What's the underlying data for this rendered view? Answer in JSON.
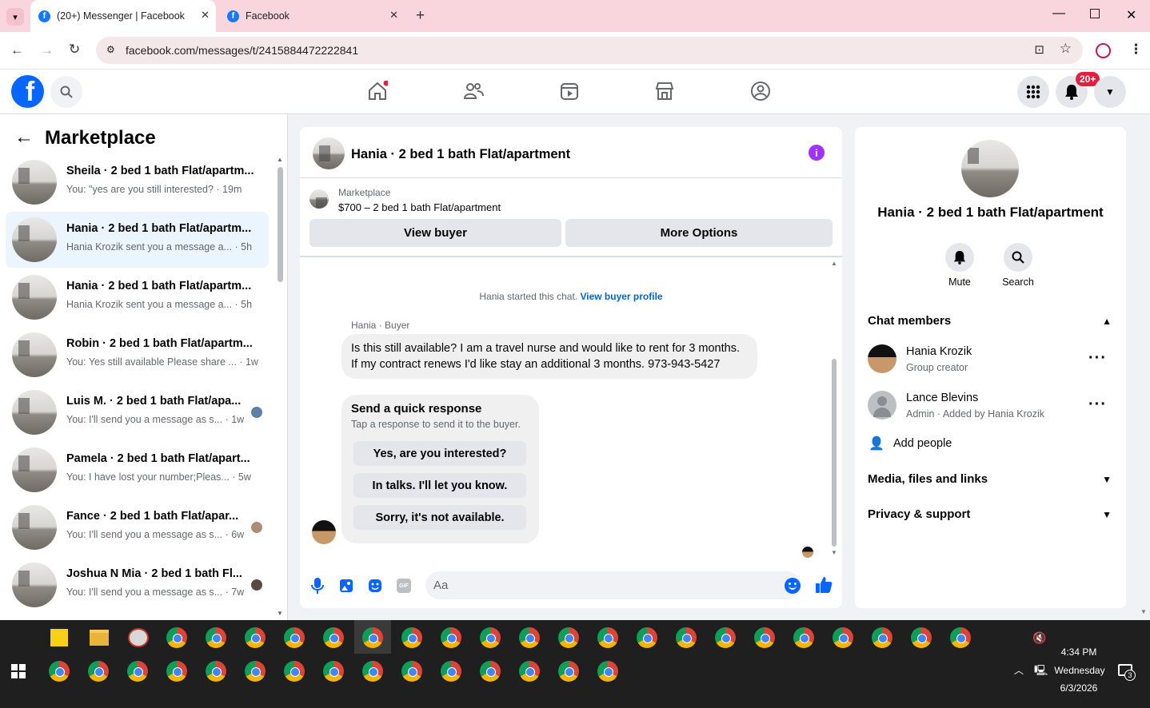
{
  "browser": {
    "tabs": [
      {
        "title": "(20+) Messenger | Facebook"
      },
      {
        "title": "Facebook"
      }
    ],
    "url": "facebook.com/messages/t/2415884472222841"
  },
  "fb": {
    "notif_badge": "20+"
  },
  "left": {
    "title": "Marketplace",
    "conversations": [
      {
        "title": "Sheila · 2 bed 1 bath Flat/apartm...",
        "snippet": "You: \"yes are you still interested? · 19m"
      },
      {
        "title": "Hania · 2 bed 1 bath Flat/apartm...",
        "snippet": "Hania Krozik sent you a message a... · 5h"
      },
      {
        "title": "Hania · 2 bed 1 bath Flat/apartm...",
        "snippet": "Hania Krozik sent you a message a... · 5h"
      },
      {
        "title": "Robin · 2 bed 1 bath Flat/apartm...",
        "snippet": "You: Yes still available Please share ... · 1w"
      },
      {
        "title": "Luis M. · 2 bed 1 bath Flat/apa...",
        "snippet": "You: I'll send you a message as s... · 1w"
      },
      {
        "title": "Pamela · 2 bed 1 bath Flat/apart...",
        "snippet": "You: I have lost your number;Pleas... · 5w"
      },
      {
        "title": "Fance · 2 bed 1 bath Flat/apar...",
        "snippet": "You: I'll send you a message as s... · 6w"
      },
      {
        "title": "Joshua N Mia · 2 bed 1 bath Fl...",
        "snippet": "You: I'll send you a message as s... · 7w"
      }
    ]
  },
  "chat": {
    "header_title": "Hania · 2 bed 1 bath Flat/apartment",
    "listing_source": "Marketplace",
    "listing_line": "$700 – 2 bed 1 bath Flat/apartment",
    "view_buyer": "View buyer",
    "more_options": "More Options",
    "started_text": "Hania started this chat.",
    "view_profile": "View buyer profile",
    "sender_label": "Hania · Buyer",
    "message": "Is this still available? I am a travel nurse and would like to rent for 3 months. If my contract renews I'd like stay an additional 3 months. 973-943-5427",
    "quick_title": "Send a quick response",
    "quick_sub": "Tap a response to send it to the buyer.",
    "quick_options": [
      "Yes, are you interested?",
      "In talks. I'll let you know.",
      "Sorry, it's not available."
    ],
    "composer_placeholder": "Aa"
  },
  "info": {
    "title": "Hania · 2 bed 1 bath Flat/apartment",
    "mute": "Mute",
    "search": "Search",
    "chat_members": "Chat members",
    "members": [
      {
        "name": "Hania Krozik",
        "role": "Group creator"
      },
      {
        "name": "Lance Blevins",
        "role": "Admin · Added by Hania Krozik"
      }
    ],
    "add_people": "Add people",
    "media": "Media, files and links",
    "privacy": "Privacy & support"
  },
  "taskbar": {
    "time": "4:34 PM",
    "day": "Wednesday",
    "date": "6/3/2026",
    "notif_count": "3"
  }
}
